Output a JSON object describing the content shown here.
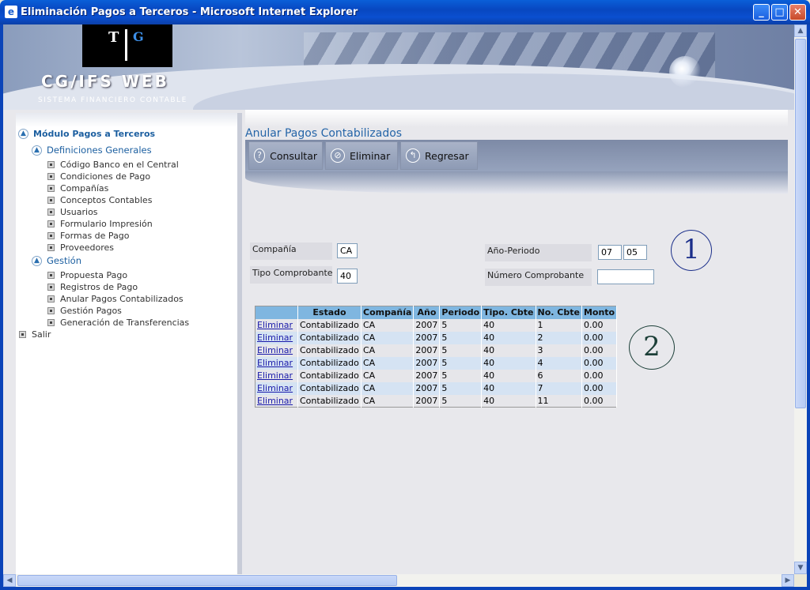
{
  "window": {
    "title": "Eliminación Pagos a Terceros - Microsoft Internet Explorer",
    "ie_icon": "e",
    "minimize": "_",
    "maximize": "□",
    "close": "✕"
  },
  "header": {
    "logo_left": "T",
    "logo_right": "G",
    "brand": "CG/IFS  WEB",
    "subtitle": "SISTEMA FINANCIERO CONTABLE"
  },
  "sidebar": {
    "module": "Módulo Pagos a Terceros",
    "groups": [
      {
        "label": "Definiciones Generales",
        "items": [
          "Código Banco en el Central",
          "Condiciones de Pago",
          "Compañías",
          "Conceptos Contables",
          "Usuarios",
          "Formulario Impresión",
          "Formas de Pago",
          "Proveedores"
        ]
      },
      {
        "label": "Gestión",
        "items": [
          "Propuesta Pago",
          "Registros de Pago",
          "Anular Pagos Contabilizados",
          "Gestión Pagos",
          "Generación de Transferencias"
        ]
      }
    ],
    "exit": "Salir"
  },
  "page": {
    "title": "Anular Pagos Contabilizados"
  },
  "toolbar": {
    "consultar": "Consultar",
    "eliminar": "Eliminar",
    "regresar": "Regresar"
  },
  "form": {
    "compania_label": "Compañía",
    "compania_value": "CA",
    "tipo_label": "Tipo Comprobante",
    "tipo_value": "40",
    "anio_label": "Año-Periodo",
    "anio_value": "07",
    "periodo_value": "05",
    "numero_label": "Número Comprobante",
    "numero_value": ""
  },
  "annotations": {
    "one": "1",
    "two": "2"
  },
  "table": {
    "columns": [
      "",
      "Estado",
      "Compañía",
      "Año",
      "Periodo",
      "Tipo. Cbte",
      "No. Cbte",
      "Monto"
    ],
    "rows": [
      [
        "Eliminar",
        "Contabilizado",
        "CA",
        "2007",
        "5",
        "40",
        "1",
        "0.00"
      ],
      [
        "Eliminar",
        "Contabilizado",
        "CA",
        "2007",
        "5",
        "40",
        "2",
        "0.00"
      ],
      [
        "Eliminar",
        "Contabilizado",
        "CA",
        "2007",
        "5",
        "40",
        "3",
        "0.00"
      ],
      [
        "Eliminar",
        "Contabilizado",
        "CA",
        "2007",
        "5",
        "40",
        "4",
        "0.00"
      ],
      [
        "Eliminar",
        "Contabilizado",
        "CA",
        "2007",
        "5",
        "40",
        "6",
        "0.00"
      ],
      [
        "Eliminar",
        "Contabilizado",
        "CA",
        "2007",
        "5",
        "40",
        "7",
        "0.00"
      ],
      [
        "Eliminar",
        "Contabilizado",
        "CA",
        "2007",
        "5",
        "40",
        "11",
        "0.00"
      ]
    ]
  },
  "colors": {
    "titlebar": "#0a4fd0",
    "link": "#1a1aaa",
    "nav_accent": "#1c5fa0",
    "table_header": "#7fb6e0"
  }
}
